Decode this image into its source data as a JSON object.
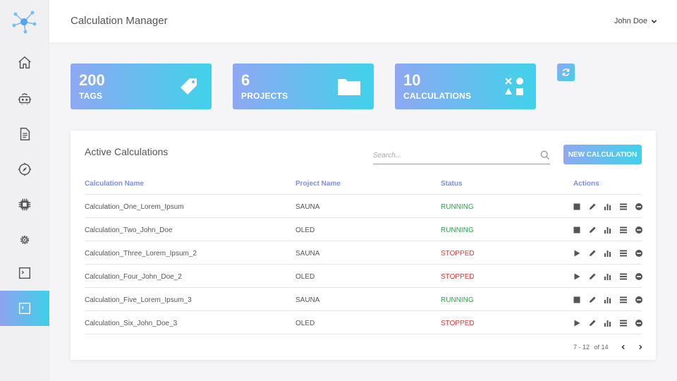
{
  "header": {
    "title": "Calculation Manager",
    "user": "John Doe"
  },
  "sidebar": {
    "items": [
      {
        "name": "home-icon"
      },
      {
        "name": "robot-icon"
      },
      {
        "name": "document-icon"
      },
      {
        "name": "compass-icon"
      },
      {
        "name": "chip-icon"
      },
      {
        "name": "gear-icon"
      },
      {
        "name": "terminal-icon"
      },
      {
        "name": "terminal-active-icon",
        "active": true
      }
    ]
  },
  "stats": {
    "tags": {
      "value": "200",
      "label": "TAGS",
      "icon": "tag-icon"
    },
    "projects": {
      "value": "6",
      "label": "PROJECTS",
      "icon": "folder-icon"
    },
    "calculations": {
      "value": "10",
      "label": "CALCULATIONS",
      "icon": "shapes-icon"
    }
  },
  "panel": {
    "title": "Active Calculations",
    "search_placeholder": "Search...",
    "new_button": "NEW CALCULATION",
    "columns": [
      "Calculation Name",
      "Project Name",
      "Status",
      "Actions"
    ],
    "rows": [
      {
        "name": "Calculation_One_Lorem_Ipsum",
        "project": "SAUNA",
        "status": "RUNNING"
      },
      {
        "name": "Calculation_Two_John_Doe",
        "project": "OLED",
        "status": "RUNNING"
      },
      {
        "name": "Calculation_Three_Lorem_Ipsum_2",
        "project": "SAUNA",
        "status": "STOPPED"
      },
      {
        "name": "Calculation_Four_John_Doe_2",
        "project": "OLED",
        "status": "STOPPED"
      },
      {
        "name": "Calculation_Five_Lorem_Ipsum_3",
        "project": "SAUNA",
        "status": "RUNNING"
      },
      {
        "name": "Calculation_Six_John_Doe_3",
        "project": "OLED",
        "status": "STOPPED"
      }
    ],
    "pagination": {
      "range": "7 - 12",
      "of_label": "of 14"
    }
  },
  "colors": {
    "accent_start": "#8ea8f2",
    "accent_end": "#3fd2ea",
    "running": "#2aa84a",
    "stopped": "#e03a3a",
    "header_text": "#7f8fe6"
  }
}
